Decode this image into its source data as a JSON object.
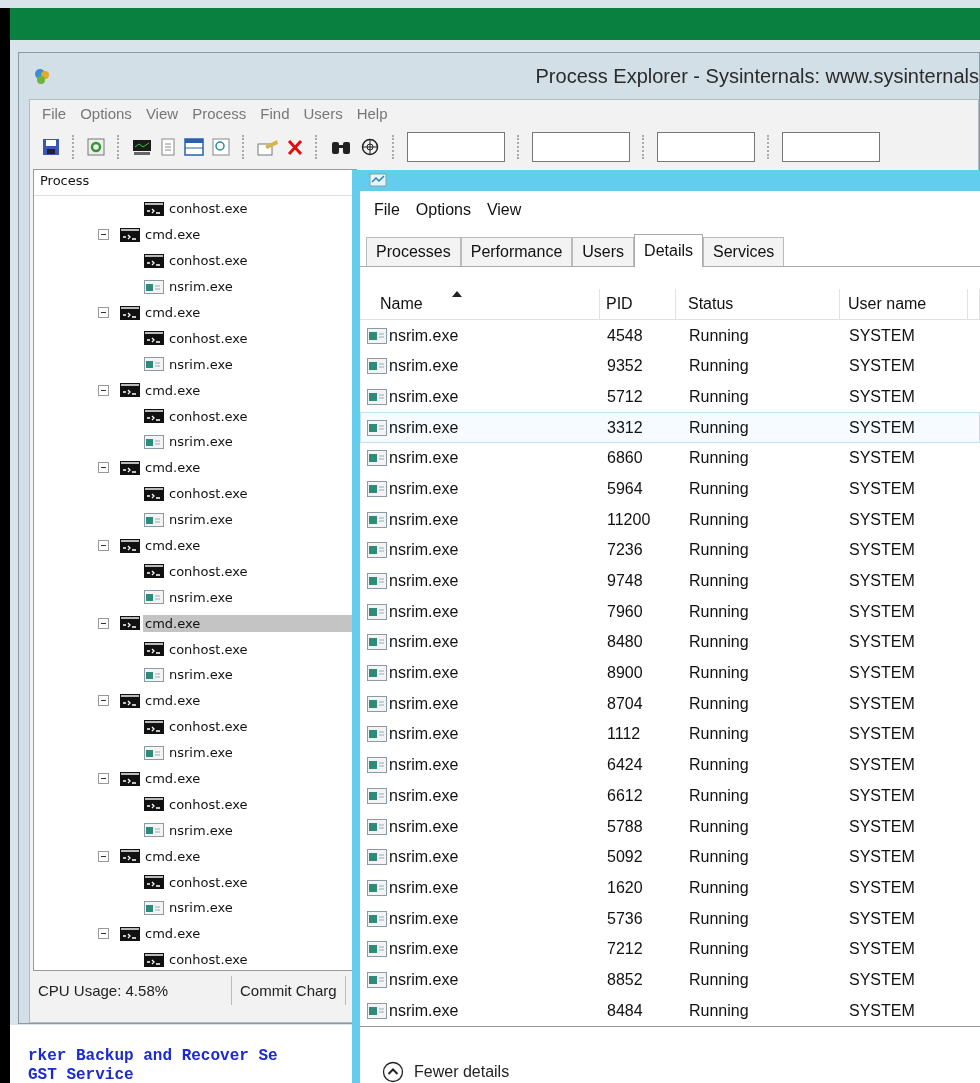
{
  "background_console": {
    "lines": [
      "rker Backup and Recover Se",
      "GST Service"
    ]
  },
  "process_explorer": {
    "title": "Process Explorer - Sysinternals: www.sysinternals",
    "menu": [
      "File",
      "Options",
      "View",
      "Process",
      "Find",
      "Users",
      "Help"
    ],
    "tree_header": "Process",
    "tree": [
      {
        "children": [
          {
            "name": "conhost.exe",
            "kind": "console",
            "selected": false
          }
        ]
      },
      {
        "name": "cmd.exe",
        "kind": "console",
        "expanded": true,
        "selected": false,
        "children": [
          {
            "name": "conhost.exe",
            "kind": "console",
            "selected": false
          },
          {
            "name": "nsrim.exe",
            "kind": "app",
            "selected": false
          }
        ]
      },
      {
        "name": "cmd.exe",
        "kind": "console",
        "expanded": true,
        "selected": false,
        "children": [
          {
            "name": "conhost.exe",
            "kind": "console",
            "selected": false
          },
          {
            "name": "nsrim.exe",
            "kind": "app",
            "selected": false
          }
        ]
      },
      {
        "name": "cmd.exe",
        "kind": "console",
        "expanded": true,
        "selected": false,
        "children": [
          {
            "name": "conhost.exe",
            "kind": "console",
            "selected": false
          },
          {
            "name": "nsrim.exe",
            "kind": "app",
            "selected": false
          }
        ]
      },
      {
        "name": "cmd.exe",
        "kind": "console",
        "expanded": true,
        "selected": false,
        "children": [
          {
            "name": "conhost.exe",
            "kind": "console",
            "selected": false
          },
          {
            "name": "nsrim.exe",
            "kind": "app",
            "selected": false
          }
        ]
      },
      {
        "name": "cmd.exe",
        "kind": "console",
        "expanded": true,
        "selected": false,
        "children": [
          {
            "name": "conhost.exe",
            "kind": "console",
            "selected": false
          },
          {
            "name": "nsrim.exe",
            "kind": "app",
            "selected": false
          }
        ]
      },
      {
        "name": "cmd.exe",
        "kind": "console",
        "expanded": true,
        "selected": true,
        "children": [
          {
            "name": "conhost.exe",
            "kind": "console",
            "selected": false
          },
          {
            "name": "nsrim.exe",
            "kind": "app",
            "selected": false
          }
        ]
      },
      {
        "name": "cmd.exe",
        "kind": "console",
        "expanded": true,
        "selected": false,
        "children": [
          {
            "name": "conhost.exe",
            "kind": "console",
            "selected": false
          },
          {
            "name": "nsrim.exe",
            "kind": "app",
            "selected": false
          }
        ]
      },
      {
        "name": "cmd.exe",
        "kind": "console",
        "expanded": true,
        "selected": false,
        "children": [
          {
            "name": "conhost.exe",
            "kind": "console",
            "selected": false
          },
          {
            "name": "nsrim.exe",
            "kind": "app",
            "selected": false
          }
        ]
      },
      {
        "name": "cmd.exe",
        "kind": "console",
        "expanded": true,
        "selected": false,
        "children": [
          {
            "name": "conhost.exe",
            "kind": "console",
            "selected": false
          },
          {
            "name": "nsrim.exe",
            "kind": "app",
            "selected": false
          }
        ]
      },
      {
        "name": "cmd.exe",
        "kind": "console",
        "expanded": true,
        "selected": false,
        "children": [
          {
            "name": "conhost.exe",
            "kind": "console",
            "selected": false
          }
        ]
      }
    ],
    "status_bar": [
      "CPU Usage: 4.58%",
      "Commit Charg"
    ]
  },
  "task_manager": {
    "menu": [
      "File",
      "Options",
      "View"
    ],
    "tabs": [
      {
        "label": "Processes",
        "selected": false
      },
      {
        "label": "Performance",
        "selected": false
      },
      {
        "label": "Users",
        "selected": false
      },
      {
        "label": "Details",
        "selected": true
      },
      {
        "label": "Services",
        "selected": false
      }
    ],
    "columns": [
      "Name",
      "PID",
      "Status",
      "User name"
    ],
    "rows": [
      {
        "name": "nsrim.exe",
        "pid": "4548",
        "status": "Running",
        "user": "SYSTEM",
        "hovered": false
      },
      {
        "name": "nsrim.exe",
        "pid": "9352",
        "status": "Running",
        "user": "SYSTEM",
        "hovered": false
      },
      {
        "name": "nsrim.exe",
        "pid": "5712",
        "status": "Running",
        "user": "SYSTEM",
        "hovered": false
      },
      {
        "name": "nsrim.exe",
        "pid": "3312",
        "status": "Running",
        "user": "SYSTEM",
        "hovered": true
      },
      {
        "name": "nsrim.exe",
        "pid": "6860",
        "status": "Running",
        "user": "SYSTEM",
        "hovered": false
      },
      {
        "name": "nsrim.exe",
        "pid": "5964",
        "status": "Running",
        "user": "SYSTEM",
        "hovered": false
      },
      {
        "name": "nsrim.exe",
        "pid": "11200",
        "status": "Running",
        "user": "SYSTEM",
        "hovered": false
      },
      {
        "name": "nsrim.exe",
        "pid": "7236",
        "status": "Running",
        "user": "SYSTEM",
        "hovered": false
      },
      {
        "name": "nsrim.exe",
        "pid": "9748",
        "status": "Running",
        "user": "SYSTEM",
        "hovered": false
      },
      {
        "name": "nsrim.exe",
        "pid": "7960",
        "status": "Running",
        "user": "SYSTEM",
        "hovered": false
      },
      {
        "name": "nsrim.exe",
        "pid": "8480",
        "status": "Running",
        "user": "SYSTEM",
        "hovered": false
      },
      {
        "name": "nsrim.exe",
        "pid": "8900",
        "status": "Running",
        "user": "SYSTEM",
        "hovered": false
      },
      {
        "name": "nsrim.exe",
        "pid": "8704",
        "status": "Running",
        "user": "SYSTEM",
        "hovered": false
      },
      {
        "name": "nsrim.exe",
        "pid": "1112",
        "status": "Running",
        "user": "SYSTEM",
        "hovered": false
      },
      {
        "name": "nsrim.exe",
        "pid": "6424",
        "status": "Running",
        "user": "SYSTEM",
        "hovered": false
      },
      {
        "name": "nsrim.exe",
        "pid": "6612",
        "status": "Running",
        "user": "SYSTEM",
        "hovered": false
      },
      {
        "name": "nsrim.exe",
        "pid": "5788",
        "status": "Running",
        "user": "SYSTEM",
        "hovered": false
      },
      {
        "name": "nsrim.exe",
        "pid": "5092",
        "status": "Running",
        "user": "SYSTEM",
        "hovered": false
      },
      {
        "name": "nsrim.exe",
        "pid": "1620",
        "status": "Running",
        "user": "SYSTEM",
        "hovered": false
      },
      {
        "name": "nsrim.exe",
        "pid": "5736",
        "status": "Running",
        "user": "SYSTEM",
        "hovered": false
      },
      {
        "name": "nsrim.exe",
        "pid": "7212",
        "status": "Running",
        "user": "SYSTEM",
        "hovered": false
      },
      {
        "name": "nsrim.exe",
        "pid": "8852",
        "status": "Running",
        "user": "SYSTEM",
        "hovered": false
      },
      {
        "name": "nsrim.exe",
        "pid": "8484",
        "status": "Running",
        "user": "SYSTEM",
        "hovered": false
      }
    ],
    "footer_link": "Fewer details"
  }
}
